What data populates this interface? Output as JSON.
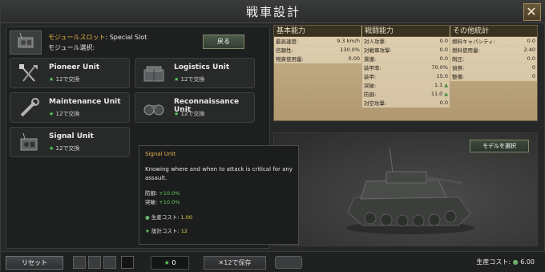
{
  "window": {
    "title": "戦車設計",
    "close_icon": "✕"
  },
  "slot": {
    "label": "モジュールスロット",
    "name": ": Special Slot",
    "select_label": "モジュール選択:",
    "back_label": "戻る"
  },
  "units": [
    {
      "name": "Pioneer Unit",
      "cost_value": "12",
      "cost_suffix": "で交換",
      "icon": "shovel-axe-icon"
    },
    {
      "name": "Logistics Unit",
      "cost_value": "12",
      "cost_suffix": "で交換",
      "icon": "crates-icon"
    },
    {
      "name": "Maintenance Unit",
      "cost_value": "12",
      "cost_suffix": "で交換",
      "icon": "wrench-icon"
    },
    {
      "name": "Reconnaissance Unit",
      "cost_value": "12",
      "cost_suffix": "で交換",
      "icon": "binoculars-icon"
    },
    {
      "name": "Signal Unit",
      "cost_value": "12",
      "cost_suffix": "で交換",
      "icon": "radio-icon"
    }
  ],
  "stats": {
    "basic": {
      "header": "基本能力",
      "rows": [
        {
          "label": "最高速度:",
          "value": "9.3 km/h"
        },
        {
          "label": "信頼性:",
          "value": "130.0%"
        },
        {
          "label": "物資使用量:",
          "value": "0.00"
        }
      ]
    },
    "combat": {
      "header": "戦闘能力",
      "rows": [
        {
          "label": "対人攻撃:",
          "value": "0.0"
        },
        {
          "label": "対戦車攻撃:",
          "value": "0.0"
        },
        {
          "label": "貫徹:",
          "value": "0.0"
        },
        {
          "label": "装甲率:",
          "value": "70.0%"
        },
        {
          "label": "装甲:",
          "value": "15.0"
        },
        {
          "label": "突破:",
          "value": "1.1",
          "up": true
        },
        {
          "label": "防御:",
          "value": "11.0",
          "up": true
        },
        {
          "label": "対空攻撃:",
          "value": "0.0"
        }
      ]
    },
    "other": {
      "header": "その他統計",
      "rows": [
        {
          "label": "燃料キャパシティ:",
          "value": "0.0"
        },
        {
          "label": "燃料使用量:",
          "value": "2.40"
        },
        {
          "label": "制圧:",
          "value": "0.0"
        },
        {
          "label": "偵察:",
          "value": "0"
        },
        {
          "label": "整備:",
          "value": "0"
        }
      ]
    }
  },
  "preview": {
    "select_model_label": "モデルを選択"
  },
  "tooltip": {
    "title": "Signal Unit",
    "description": "Knowing where and when to attack is critical for any assault.",
    "effects": [
      {
        "label": "防御:",
        "value": "+10.0%"
      },
      {
        "label": "突破:",
        "value": "+10.0%"
      }
    ],
    "production_label": "生産コスト:",
    "production_value": "1.00",
    "design_label": "設計コスト:",
    "design_value": "12"
  },
  "bottom": {
    "reset_label": "リセット",
    "points_value": "0",
    "save_label": "✕12で保存",
    "production_cost_label": "生産コスト:",
    "production_cost_value": "6.00"
  },
  "colors": {
    "accent_gold": "#e8b64a",
    "positive_green": "#5bd05b",
    "stats_bg": "#c8b48c"
  }
}
